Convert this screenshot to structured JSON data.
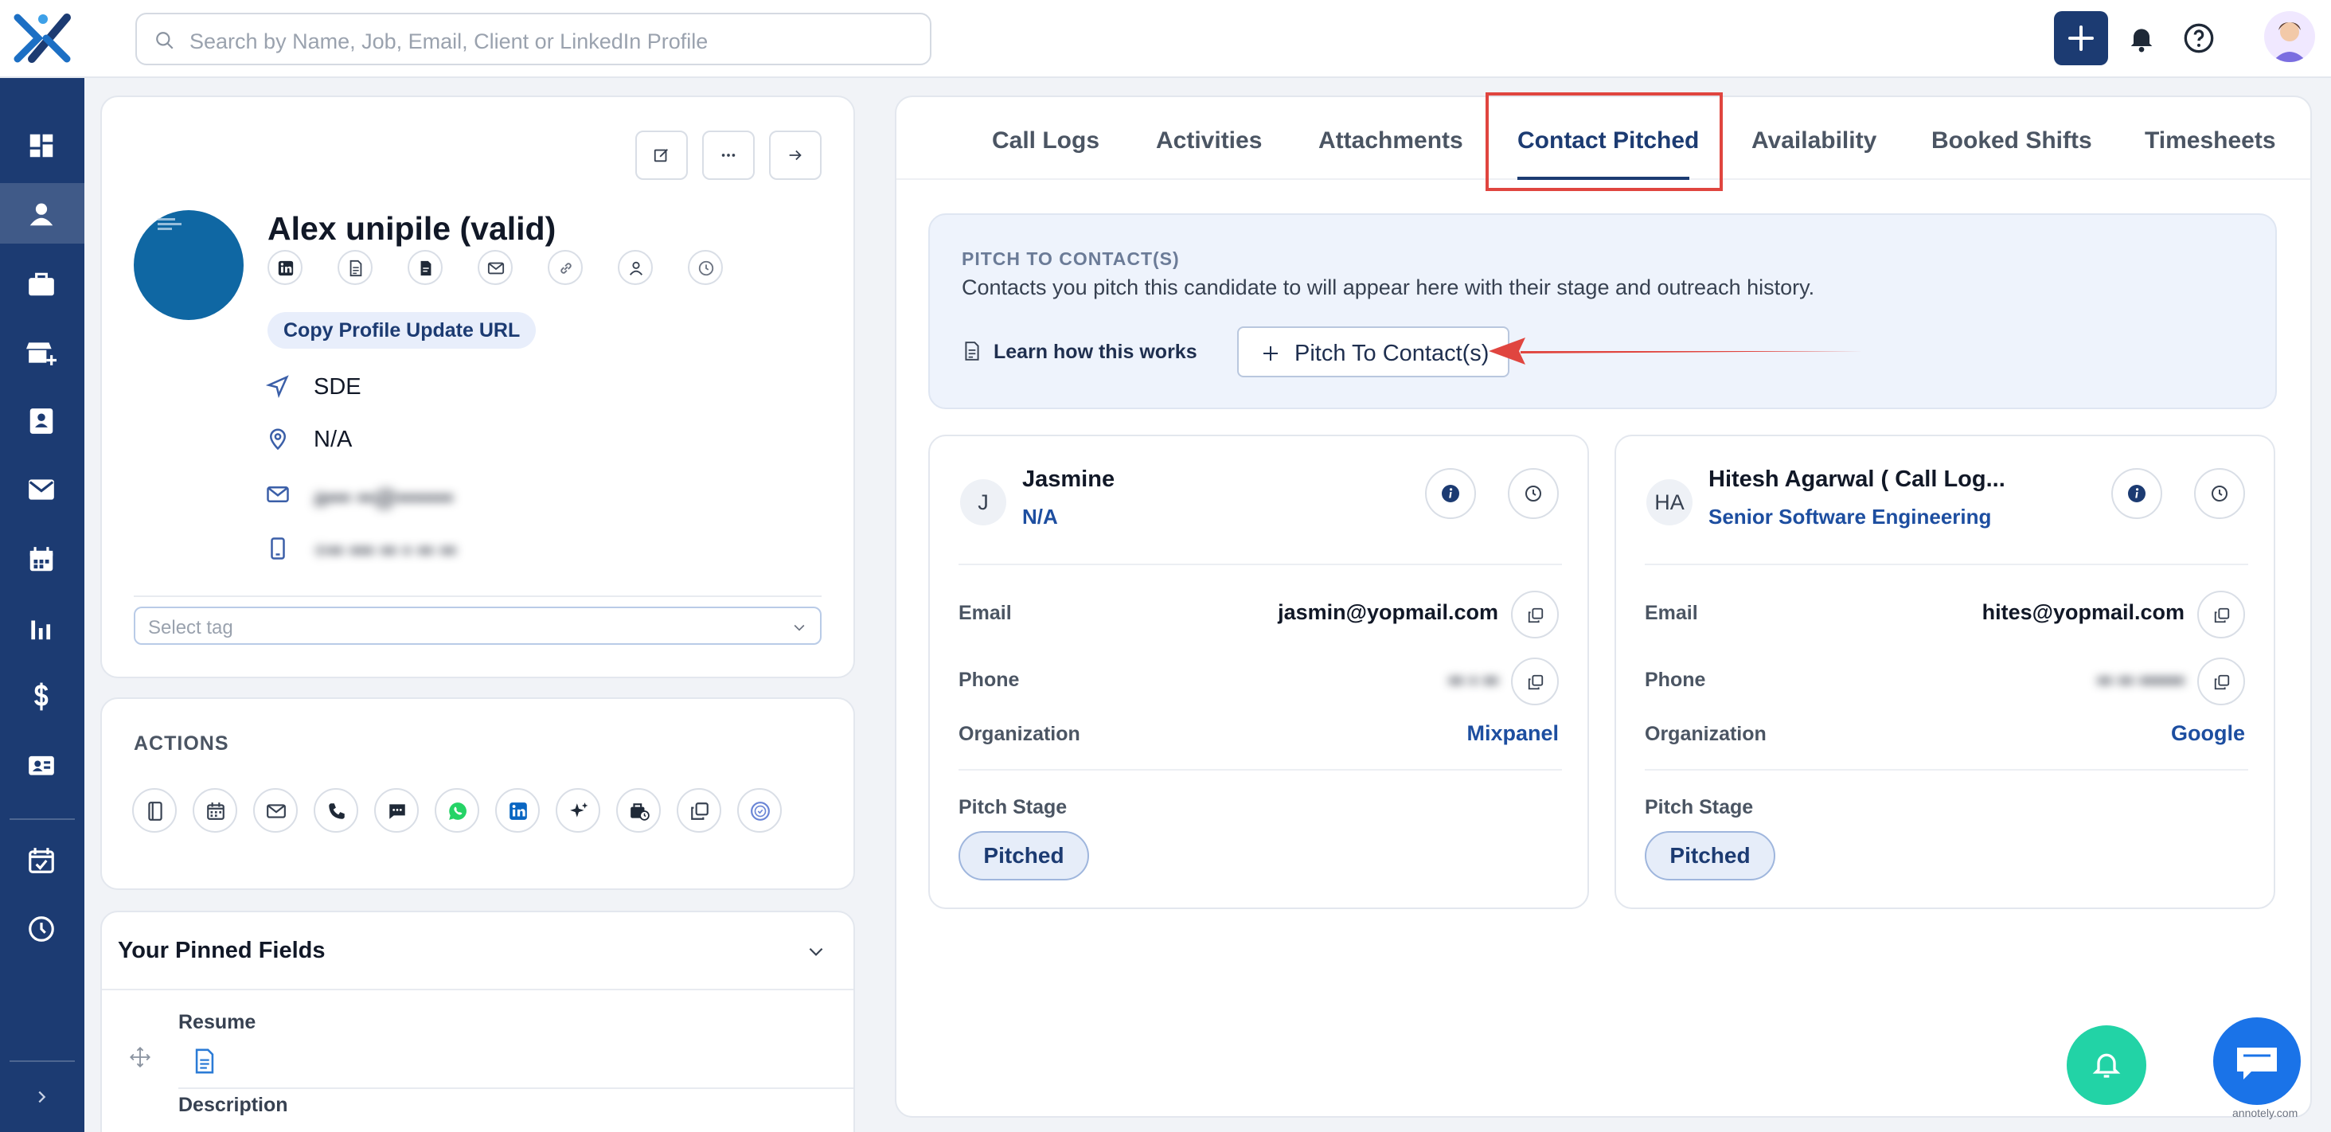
{
  "search": {
    "placeholder": "Search by Name, Job, Email, Client or LinkedIn Profile"
  },
  "sidebar": {
    "items": [
      {
        "icon": "dashboard-icon"
      },
      {
        "icon": "person-icon",
        "active": true
      },
      {
        "icon": "briefcase-icon"
      },
      {
        "icon": "store-add-icon"
      },
      {
        "icon": "contact-card-icon"
      },
      {
        "icon": "mail-icon"
      },
      {
        "icon": "calendar-icon"
      },
      {
        "icon": "bar-chart-icon"
      },
      {
        "icon": "dollar-icon"
      },
      {
        "icon": "id-card-icon"
      },
      {
        "icon": "calendar-check-icon"
      },
      {
        "icon": "clock-icon"
      }
    ],
    "expand_icon": "chevron-right-icon"
  },
  "profile": {
    "name": "Alex unipile (valid)",
    "copy_url_label": "Copy Profile Update URL",
    "title": "SDE",
    "location": "N/A",
    "email_masked": "a••• ••@•••••••",
    "phone_masked": "+•• •••  ••  • ••  ••",
    "tag_placeholder": "Select tag"
  },
  "actions": {
    "title": "ACTIONS"
  },
  "pinned": {
    "title": "Your Pinned Fields",
    "resume_label": "Resume",
    "description_label": "Description"
  },
  "tabs": [
    {
      "label": "Call Logs"
    },
    {
      "label": "Activities"
    },
    {
      "label": "Attachments"
    },
    {
      "label": "Contact Pitched",
      "active": true
    },
    {
      "label": "Availability"
    },
    {
      "label": "Booked Shifts"
    },
    {
      "label": "Timesheets"
    }
  ],
  "pitch": {
    "title": "PITCH TO CONTACT(S)",
    "description": "Contacts you pitch this candidate to will appear here with their stage and outreach history.",
    "learn_label": "Learn how this works",
    "button_label": "Pitch To Contact(s)"
  },
  "field_labels": {
    "email": "Email",
    "phone": "Phone",
    "organization": "Organization",
    "pitch_stage": "Pitch Stage"
  },
  "contacts": [
    {
      "initials": "J",
      "name": "Jasmine",
      "title": "N/A",
      "email": "jasmin@yopmail.com",
      "phone_masked": "••            • ••",
      "organization": "Mixpanel",
      "stage": "Pitched"
    },
    {
      "initials": "HA",
      "name": "Hitesh Agarwal ( Call Log...",
      "title": "Senior Software Engineering",
      "email": "hites@yopmail.com",
      "phone_masked": "•• ••    ••••••",
      "organization": "Google",
      "stage": "Pitched"
    }
  ],
  "colors": {
    "brand_navy": "#1c3b72",
    "link_blue": "#1d4ea0",
    "highlight_red": "#e0453f",
    "fab_green": "#22d3a6",
    "fab_blue": "#1a73e8"
  },
  "watermark": "annotely.com"
}
